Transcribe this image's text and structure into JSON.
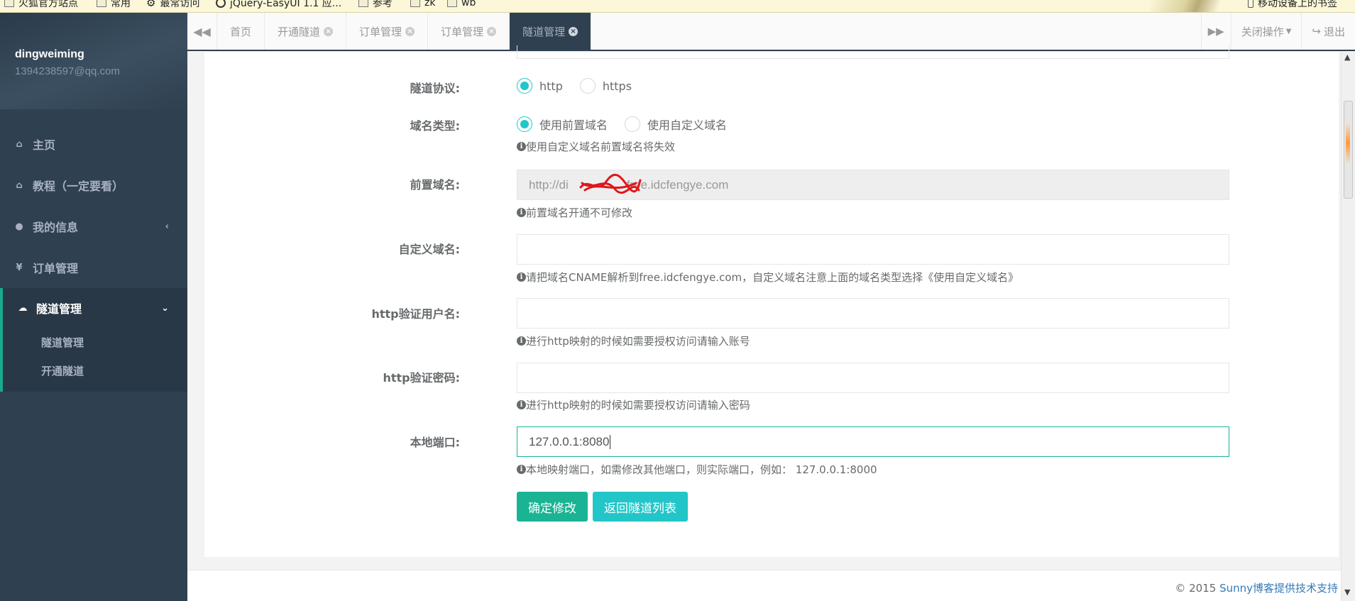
{
  "bookmarks": [
    {
      "icon": "folder-icon",
      "label": "火狐官方站点"
    },
    {
      "icon": "folder-icon",
      "label": "常用"
    },
    {
      "icon": "gear-icon",
      "label": "最常访问"
    },
    {
      "icon": "globe-icon",
      "label": "jQuery-EasyUI 1.1 应..."
    },
    {
      "icon": "folder-icon",
      "label": "参考"
    },
    {
      "icon": "folder-icon",
      "label": "zk"
    },
    {
      "icon": "folder-icon",
      "label": "wb"
    },
    {
      "icon": "phone-icon",
      "label": "移动设备上的书签"
    }
  ],
  "sidebar": {
    "user_name": "dingweiming",
    "user_email": "1394238597@qq.com",
    "items": [
      {
        "icon": "home-icon",
        "label": "主页"
      },
      {
        "icon": "home-icon",
        "label": "教程（一定要看）"
      },
      {
        "icon": "user-icon",
        "label": "我的信息"
      },
      {
        "icon": "yen-icon",
        "label": "订单管理"
      },
      {
        "icon": "cloud-icon",
        "label": "隧道管理"
      }
    ],
    "sub_items": [
      "隧道管理",
      "开通隧道"
    ]
  },
  "tabs": {
    "items": [
      {
        "label": "首页",
        "closable": false,
        "active": false
      },
      {
        "label": "开通隧道",
        "closable": true,
        "active": false
      },
      {
        "label": "订单管理",
        "closable": true,
        "active": false
      },
      {
        "label": "订单管理",
        "closable": true,
        "active": false
      },
      {
        "label": "隧道管理",
        "closable": true,
        "active": true
      }
    ],
    "close_ops": "关闭操作",
    "logout": "退出"
  },
  "form": {
    "protocol": {
      "label": "隧道协议:",
      "options": [
        "http",
        "https"
      ],
      "selected": "http"
    },
    "domain_type": {
      "label": "域名类型:",
      "options": [
        "使用前置域名",
        "使用自定义域名"
      ],
      "selected": "使用前置域名",
      "help": "使用自定义域名前置域名将失效"
    },
    "prefix_domain": {
      "label": "前置域名:",
      "value_start": "http://di",
      "value_end": "free.idcfengye.com",
      "help": "前置域名开通不可修改"
    },
    "custom_domain": {
      "label": "自定义域名:",
      "value": "",
      "help": "请把域名CNAME解析到free.idcfengye.com，自定义域名注意上面的域名类型选择《使用自定义域名》"
    },
    "http_user": {
      "label": "http验证用户名:",
      "value": "",
      "help": "进行http映射的时候如需要授权访问请输入账号"
    },
    "http_pass": {
      "label": "http验证密码:",
      "value": "",
      "help": "进行http映射的时候如需要授权访问请输入密码"
    },
    "local_port": {
      "label": "本地端口:",
      "value": "127.0.0.1:8080",
      "help": "本地映射端口，如需修改其他端口，则实际端口，例如： 127.0.0.1:8000"
    },
    "submit": "确定修改",
    "back": "返回隧道列表"
  },
  "footer": {
    "copyright": "© 2015 ",
    "link": "Sunny博客提供技术支持"
  },
  "colors": {
    "sidebar": "#2f4050",
    "primary": "#1ab394",
    "info": "#23c6c8",
    "link": "#337ab7"
  }
}
